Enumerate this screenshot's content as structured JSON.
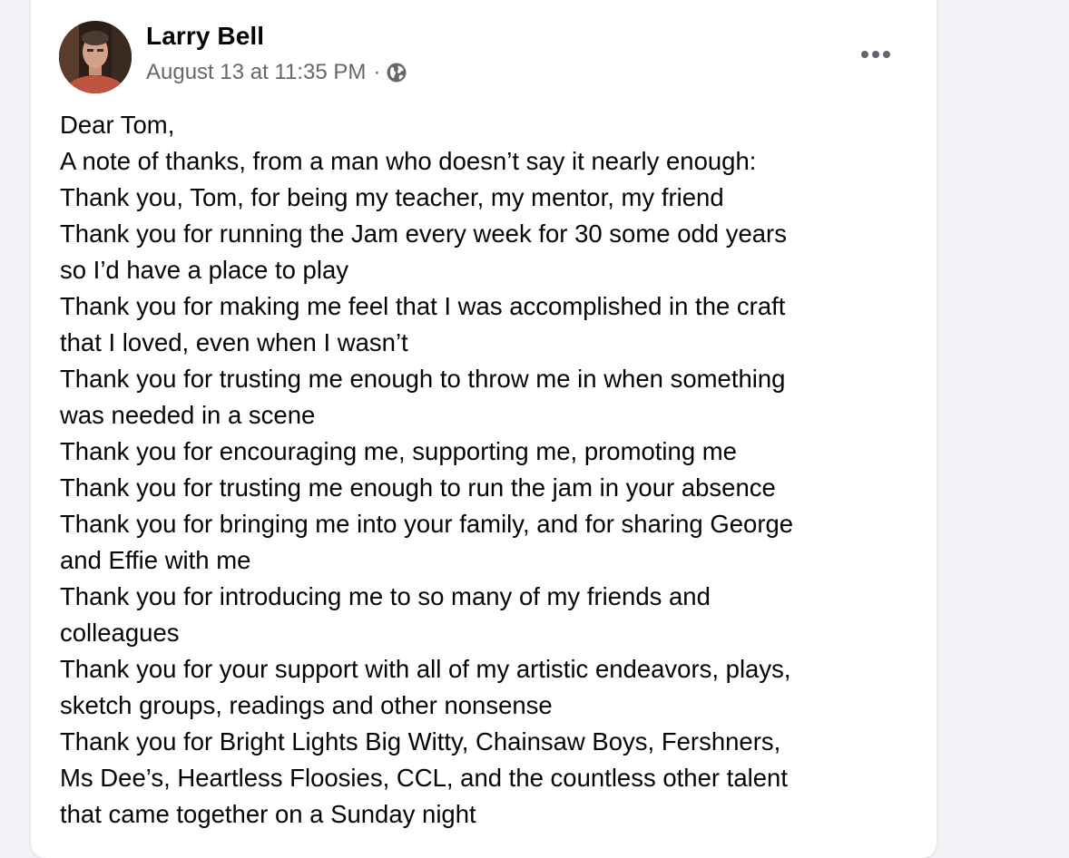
{
  "post": {
    "author": "Larry Bell",
    "timestamp": "August 13 at 11:35 PM",
    "separator": "·",
    "privacy_icon": "globe-icon",
    "more_icon": "more-options-icon",
    "lines": [
      "Dear Tom,",
      "A note of thanks, from a man who doesn’t say it nearly enough:",
      "Thank you, Tom,  for being my teacher, my mentor, my friend",
      "Thank you for running the Jam every week for 30 some odd years",
      "so I’d have a place to play",
      "Thank you for making me feel that I was accomplished in the craft",
      "that I loved, even when I wasn’t",
      "Thank you for trusting me enough to throw me in when something",
      "was needed in a scene",
      "Thank you for encouraging me, supporting me, promoting me",
      "Thank you for trusting me enough to run the jam in your absence",
      "Thank you for bringing me into your family, and for sharing George",
      "and Effie with me",
      "Thank you for introducing me to so many of my friends and",
      "colleagues",
      "Thank you for your support with all of my artistic endeavors, plays,",
      "sketch groups, readings and other nonsense",
      "Thank you for Bright Lights Big Witty, Chainsaw Boys, Fershners,",
      "Ms Dee’s, Heartless Floosies, CCL, and the countless other talent",
      "that came together on a Sunday night"
    ]
  },
  "colors": {
    "background": "#f0f2f5",
    "card": "#ffffff",
    "text_primary": "#050505",
    "text_secondary": "#65676b"
  }
}
